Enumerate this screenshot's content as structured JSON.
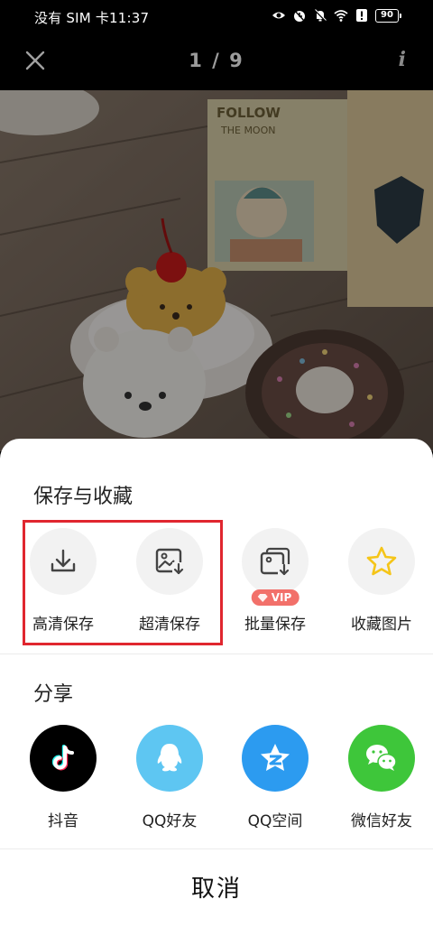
{
  "status_bar": {
    "carrier_time": "没有 SIM 卡11:37",
    "battery": "90",
    "icons": [
      "eye-icon",
      "alarm-icon",
      "mute-icon",
      "wifi-icon",
      "alert-icon",
      "battery-icon"
    ]
  },
  "viewer": {
    "counter": "1 / 9",
    "info_label": "i",
    "photo_text": "FOLLOW THE MOON"
  },
  "save_section": {
    "title": "保存与收藏",
    "items": [
      {
        "label": "高清保存",
        "icon": "download-icon"
      },
      {
        "label": "超清保存",
        "icon": "image-download-icon"
      },
      {
        "label": "批量保存",
        "icon": "batch-save-icon",
        "badge": "VIP"
      },
      {
        "label": "收藏图片",
        "icon": "star-icon"
      }
    ]
  },
  "share_section": {
    "title": "分享",
    "items": [
      {
        "label": "抖音",
        "icon": "douyin-icon",
        "color": "#000000"
      },
      {
        "label": "QQ好友",
        "icon": "qq-icon",
        "color": "#5ec6f2"
      },
      {
        "label": "QQ空间",
        "icon": "qzone-icon",
        "color": "#2c9bf0"
      },
      {
        "label": "微信好友",
        "icon": "wechat-icon",
        "color": "#3ec63a"
      }
    ]
  },
  "cancel_label": "取消",
  "colors": {
    "highlight": "#e0262f",
    "vip": "#f2706a",
    "star": "#f5c518"
  }
}
